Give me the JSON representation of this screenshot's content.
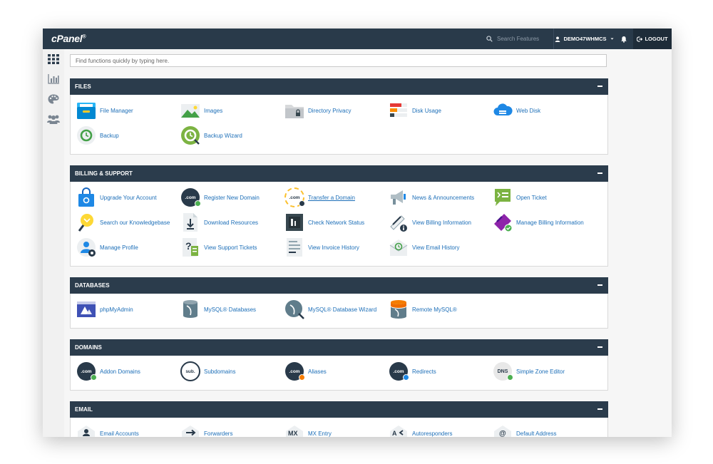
{
  "topbar": {
    "logo": "cPanel",
    "logo_mark": "®",
    "search_placeholder": "Search Features",
    "username": "DEMO47WHMCS",
    "logout_label": "LOGOUT"
  },
  "quick_search": {
    "placeholder": "Find functions quickly by typing here."
  },
  "sections": {
    "files": {
      "title": "FILES",
      "items": [
        {
          "label": "File Manager",
          "icon": "file-manager-icon"
        },
        {
          "label": "Images",
          "icon": "images-icon"
        },
        {
          "label": "Directory Privacy",
          "icon": "directory-privacy-icon"
        },
        {
          "label": "Disk Usage",
          "icon": "disk-usage-icon"
        },
        {
          "label": "Web Disk",
          "icon": "web-disk-icon"
        },
        {
          "label": "Backup",
          "icon": "backup-icon"
        },
        {
          "label": "Backup Wizard",
          "icon": "backup-wizard-icon"
        }
      ]
    },
    "billing": {
      "title": "BILLING & SUPPORT",
      "items": [
        {
          "label": "Upgrade Your Account",
          "icon": "shopping-bag-icon"
        },
        {
          "label": "Register New Domain",
          "icon": "register-domain-icon",
          "text": ".com"
        },
        {
          "label": "Transfer a Domain",
          "icon": "transfer-domain-icon",
          "text": ".com"
        },
        {
          "label": "News & Announcements",
          "icon": "megaphone-icon"
        },
        {
          "label": "Open Ticket",
          "icon": "open-ticket-icon"
        },
        {
          "label": "Search our Knowledgebase",
          "icon": "lightbulb-icon"
        },
        {
          "label": "Download Resources",
          "icon": "download-icon"
        },
        {
          "label": "Check Network Status",
          "icon": "network-status-icon"
        },
        {
          "label": "View Billing Information",
          "icon": "billing-info-icon"
        },
        {
          "label": "Manage Billing Information",
          "icon": "manage-billing-icon"
        },
        {
          "label": "Manage Profile",
          "icon": "profile-icon"
        },
        {
          "label": "View Support Tickets",
          "icon": "support-tickets-icon",
          "text": "?"
        },
        {
          "label": "View Invoice History",
          "icon": "invoice-history-icon"
        },
        {
          "label": "View Email History",
          "icon": "email-history-icon"
        }
      ]
    },
    "databases": {
      "title": "DATABASES",
      "items": [
        {
          "label": "phpMyAdmin",
          "icon": "phpmyadmin-icon"
        },
        {
          "label": "MySQL® Databases",
          "icon": "mysql-databases-icon"
        },
        {
          "label": "MySQL® Database Wizard",
          "icon": "mysql-wizard-icon"
        },
        {
          "label": "Remote MySQL®",
          "icon": "remote-mysql-icon"
        }
      ]
    },
    "domains": {
      "title": "DOMAINS",
      "items": [
        {
          "label": "Addon Domains",
          "icon": "addon-domains-icon",
          "text": ".com"
        },
        {
          "label": "Subdomains",
          "icon": "subdomains-icon",
          "text": "sub."
        },
        {
          "label": "Aliases",
          "icon": "aliases-icon",
          "text": ".com"
        },
        {
          "label": "Redirects",
          "icon": "redirects-icon",
          "text": ".com"
        },
        {
          "label": "Simple Zone Editor",
          "icon": "zone-editor-icon",
          "text": "DNS"
        }
      ]
    },
    "email": {
      "title": "EMAIL",
      "items": [
        {
          "label": "Email Accounts",
          "icon": "email-accounts-icon"
        },
        {
          "label": "Forwarders",
          "icon": "forwarders-icon"
        },
        {
          "label": "MX Entry",
          "icon": "mx-entry-icon",
          "text": "MX"
        },
        {
          "label": "Autoresponders",
          "icon": "autoresponders-icon",
          "text": "A"
        },
        {
          "label": "Default Address",
          "icon": "default-address-icon",
          "text": "@"
        }
      ]
    }
  },
  "colors": {
    "topbar": "#293a4a",
    "panel_header": "#2b3c4c",
    "link": "#1d6fb8",
    "accent_green": "#4caf50",
    "accent_orange": "#f57c00",
    "accent_blue": "#1e88e5"
  }
}
